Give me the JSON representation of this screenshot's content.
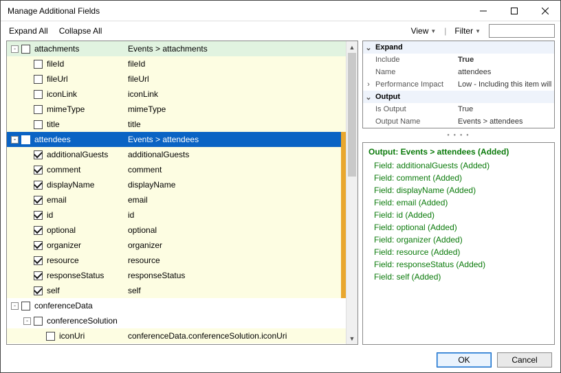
{
  "window": {
    "title": "Manage Additional Fields"
  },
  "toolbar": {
    "expand_all": "Expand All",
    "collapse_all": "Collapse All",
    "view": "View",
    "filter": "Filter",
    "filter_value": ""
  },
  "tree": {
    "rows": [
      {
        "depth": 0,
        "expander": "-",
        "checked": false,
        "name": "attachments",
        "path": "Events > attachments",
        "style": "green"
      },
      {
        "depth": 1,
        "expander": "",
        "checked": false,
        "name": "fileId",
        "path": "fileId",
        "style": "yellow"
      },
      {
        "depth": 1,
        "expander": "",
        "checked": false,
        "name": "fileUrl",
        "path": "fileUrl",
        "style": "yellow"
      },
      {
        "depth": 1,
        "expander": "",
        "checked": false,
        "name": "iconLink",
        "path": "iconLink",
        "style": "yellow"
      },
      {
        "depth": 1,
        "expander": "",
        "checked": false,
        "name": "mimeType",
        "path": "mimeType",
        "style": "yellow"
      },
      {
        "depth": 1,
        "expander": "",
        "checked": false,
        "name": "title",
        "path": "title",
        "style": "yellow"
      },
      {
        "depth": 0,
        "expander": "-",
        "checked": true,
        "name": "attendees",
        "path": "Events > attendees",
        "style": "selected",
        "orange": true
      },
      {
        "depth": 1,
        "expander": "",
        "checked": true,
        "name": "additionalGuests",
        "path": "additionalGuests",
        "style": "yellow",
        "orange": true
      },
      {
        "depth": 1,
        "expander": "",
        "checked": true,
        "name": "comment",
        "path": "comment",
        "style": "yellow",
        "orange": true
      },
      {
        "depth": 1,
        "expander": "",
        "checked": true,
        "name": "displayName",
        "path": "displayName",
        "style": "yellow",
        "orange": true
      },
      {
        "depth": 1,
        "expander": "",
        "checked": true,
        "name": "email",
        "path": "email",
        "style": "yellow",
        "orange": true
      },
      {
        "depth": 1,
        "expander": "",
        "checked": true,
        "name": "id",
        "path": "id",
        "style": "yellow",
        "orange": true
      },
      {
        "depth": 1,
        "expander": "",
        "checked": true,
        "name": "optional",
        "path": "optional",
        "style": "yellow",
        "orange": true
      },
      {
        "depth": 1,
        "expander": "",
        "checked": true,
        "name": "organizer",
        "path": "organizer",
        "style": "yellow",
        "orange": true
      },
      {
        "depth": 1,
        "expander": "",
        "checked": true,
        "name": "resource",
        "path": "resource",
        "style": "yellow",
        "orange": true
      },
      {
        "depth": 1,
        "expander": "",
        "checked": true,
        "name": "responseStatus",
        "path": "responseStatus",
        "style": "yellow",
        "orange": true
      },
      {
        "depth": 1,
        "expander": "",
        "checked": true,
        "name": "self",
        "path": "self",
        "style": "yellow",
        "orange": true
      },
      {
        "depth": 0,
        "expander": "-",
        "checked": false,
        "name": "conferenceData",
        "path": "",
        "style": "white"
      },
      {
        "depth": 1,
        "expander": "-",
        "checked": false,
        "name": "conferenceSolution",
        "path": "",
        "style": "white"
      },
      {
        "depth": 2,
        "expander": "",
        "checked": false,
        "name": "iconUri",
        "path": "conferenceData.conferenceSolution.iconUri",
        "style": "yellow"
      }
    ]
  },
  "propgrid": {
    "cat_expand": "Expand",
    "include_label": "Include",
    "include_value": "True",
    "name_label": "Name",
    "name_value": "attendees",
    "perf_label": "Performance Impact",
    "perf_value": "Low - Including this item will ha",
    "cat_output": "Output",
    "isout_label": "Is Output",
    "isout_value": "True",
    "outname_label": "Output Name",
    "outname_value": "Events > attendees"
  },
  "output": {
    "title": "Output: Events > attendees (Added)",
    "lines": [
      "Field: additionalGuests (Added)",
      "Field: comment (Added)",
      "Field: displayName (Added)",
      "Field: email (Added)",
      "Field: id (Added)",
      "Field: optional (Added)",
      "Field: organizer (Added)",
      "Field: resource (Added)",
      "Field: responseStatus (Added)",
      "Field: self (Added)"
    ]
  },
  "footer": {
    "ok": "OK",
    "cancel": "Cancel"
  }
}
